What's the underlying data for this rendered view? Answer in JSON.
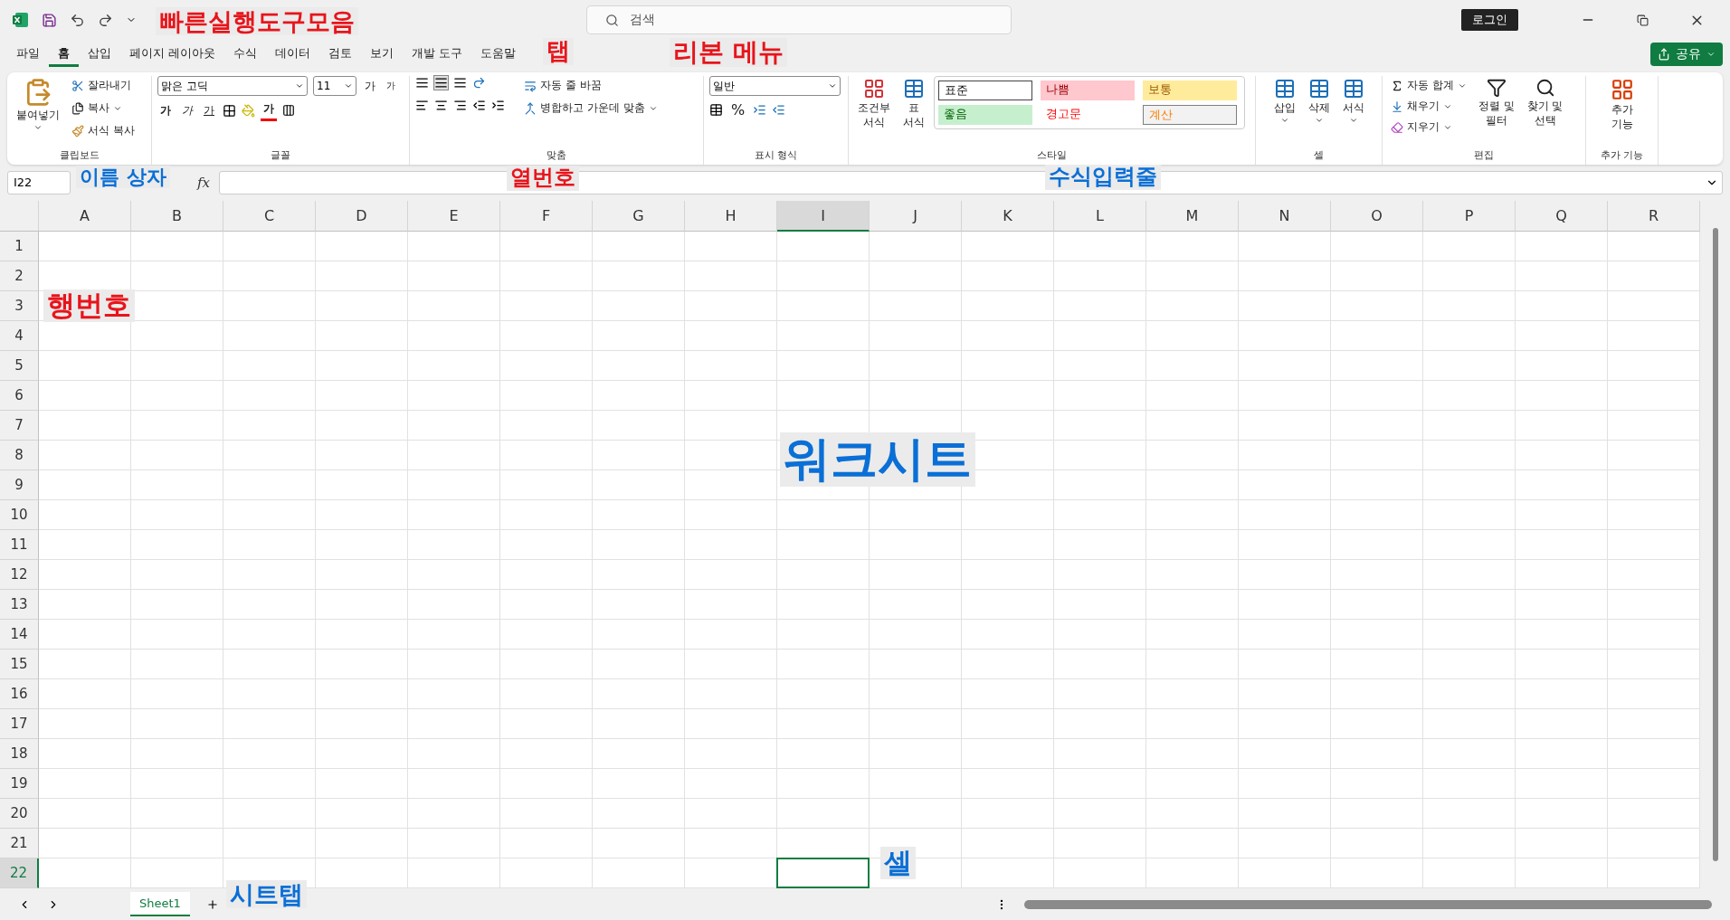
{
  "title_bar": {
    "search": {
      "placeholder": "검색"
    },
    "login": "로그인"
  },
  "tabs": [
    {
      "label": "파일",
      "selected": false
    },
    {
      "label": "홈",
      "selected": true
    },
    {
      "label": "삽입",
      "selected": false
    },
    {
      "label": "페이지 레이아웃",
      "selected": false
    },
    {
      "label": "수식",
      "selected": false
    },
    {
      "label": "데이터",
      "selected": false
    },
    {
      "label": "검토",
      "selected": false
    },
    {
      "label": "보기",
      "selected": false
    },
    {
      "label": "개발 도구",
      "selected": false
    },
    {
      "label": "도움말",
      "selected": false
    }
  ],
  "share": "공유",
  "ribbon": {
    "clipboard": {
      "label": "클립보드",
      "paste": "붙여넣기",
      "cut": "잘라내기",
      "copy": "복사",
      "format_painter": "서식 복사"
    },
    "font": {
      "label": "글꼴",
      "font_name": "맑은 고딕",
      "font_size": "11",
      "grow": "가",
      "shrink": "가",
      "bold": "가",
      "italic": "가",
      "underline": "가",
      "font_color": "가"
    },
    "alignment": {
      "label": "맞춤",
      "wrap_text": "자동 줄 바꿈",
      "merge": "병합하고 가운데 맞춤"
    },
    "number": {
      "label": "표시 형식",
      "format": "일반",
      "percent": "%"
    },
    "styles": {
      "label": "스타일",
      "conditional": [
        "조건부",
        "서식"
      ],
      "table_format": [
        "표",
        "서식"
      ],
      "cells": [
        {
          "label": "표준",
          "kind": "normal"
        },
        {
          "label": "나쁨",
          "kind": "bad"
        },
        {
          "label": "보통",
          "kind": "neutral"
        },
        {
          "label": "좋음",
          "kind": "good"
        },
        {
          "label": "경고문",
          "kind": "warning"
        },
        {
          "label": "계산",
          "kind": "calculation"
        }
      ]
    },
    "cells": {
      "label": "셀",
      "buttons": [
        "삽입",
        "삭제",
        "서식"
      ]
    },
    "editing": {
      "label": "편집",
      "autosum": "자동 합계",
      "fill": "채우기",
      "clear": "지우기",
      "sort": [
        "정렬 및",
        "필터"
      ],
      "find": [
        "찾기 및",
        "선택"
      ]
    },
    "addins": {
      "label": "추가 기능",
      "button": [
        "추가",
        "기능"
      ]
    }
  },
  "formula_bar": {
    "name_box": "I22",
    "fx": "fx"
  },
  "grid": {
    "columns": [
      {
        "label": "A",
        "selected": false
      },
      {
        "label": "B",
        "selected": false
      },
      {
        "label": "C",
        "selected": false
      },
      {
        "label": "D",
        "selected": false
      },
      {
        "label": "E",
        "selected": false
      },
      {
        "label": "F",
        "selected": false
      },
      {
        "label": "G",
        "selected": false
      },
      {
        "label": "H",
        "selected": false
      },
      {
        "label": "I",
        "selected": true
      },
      {
        "label": "J",
        "selected": false
      },
      {
        "label": "K",
        "selected": false
      },
      {
        "label": "L",
        "selected": false
      },
      {
        "label": "M",
        "selected": false
      },
      {
        "label": "N",
        "selected": false
      },
      {
        "label": "O",
        "selected": false
      },
      {
        "label": "P",
        "selected": false
      },
      {
        "label": "Q",
        "selected": false
      },
      {
        "label": "R",
        "selected": false
      }
    ],
    "rows": [
      {
        "label": "1",
        "selected": false
      },
      {
        "label": "2",
        "selected": false
      },
      {
        "label": "3",
        "selected": false
      },
      {
        "label": "4",
        "selected": false
      },
      {
        "label": "5",
        "selected": false
      },
      {
        "label": "6",
        "selected": false
      },
      {
        "label": "7",
        "selected": false
      },
      {
        "label": "8",
        "selected": false
      },
      {
        "label": "9",
        "selected": false
      },
      {
        "label": "10",
        "selected": false
      },
      {
        "label": "11",
        "selected": false
      },
      {
        "label": "12",
        "selected": false
      },
      {
        "label": "13",
        "selected": false
      },
      {
        "label": "14",
        "selected": false
      },
      {
        "label": "15",
        "selected": false
      },
      {
        "label": "16",
        "selected": false
      },
      {
        "label": "17",
        "selected": false
      },
      {
        "label": "18",
        "selected": false
      },
      {
        "label": "19",
        "selected": false
      },
      {
        "label": "20",
        "selected": false
      },
      {
        "label": "21",
        "selected": false
      },
      {
        "label": "22",
        "selected": true
      }
    ]
  },
  "sheet_tabs": [
    {
      "label": "Sheet1",
      "selected": true
    }
  ],
  "annotations": [
    {
      "text": "빠른실행도구모음",
      "color": "#e8141b"
    },
    {
      "text": "탭",
      "color": "#e8141b"
    },
    {
      "text": "리본 메뉴",
      "color": "#e8141b"
    },
    {
      "text": "이름 상자",
      "color": "#0a6fd6"
    },
    {
      "text": "열번호",
      "color": "#e8141b"
    },
    {
      "text": "수식입력줄",
      "color": "#0a6fd6"
    },
    {
      "text": "행번호",
      "color": "#e8141b"
    },
    {
      "text": "워크시트",
      "color": "#0a6fd6"
    },
    {
      "text": "셀",
      "color": "#0a6fd6"
    },
    {
      "text": "시트탭",
      "color": "#0a6fd6"
    }
  ]
}
